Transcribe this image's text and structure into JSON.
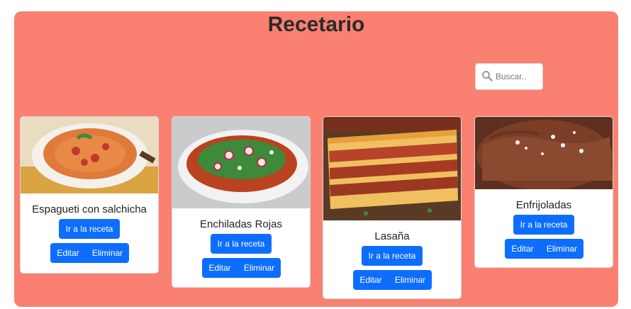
{
  "page": {
    "title": "Recetario"
  },
  "search": {
    "placeholder": "Buscar.."
  },
  "recipes": [
    {
      "name": "Espagueti con salchicha",
      "go_label": "Ir a la receta",
      "edit_label": "Editar",
      "delete_label": "Eliminar"
    },
    {
      "name": "Enchiladas Rojas",
      "go_label": "Ir a la receta",
      "edit_label": "Editar",
      "delete_label": "Eliminar"
    },
    {
      "name": "Lasaña",
      "go_label": "Ir a la receta",
      "edit_label": "Editar",
      "delete_label": "Eliminar"
    },
    {
      "name": "Enfrijoladas",
      "go_label": "Ir a la receta",
      "edit_label": "Editar",
      "delete_label": "Eliminar"
    }
  ],
  "colors": {
    "panel": "#fa8072",
    "button": "#0d6efd"
  }
}
